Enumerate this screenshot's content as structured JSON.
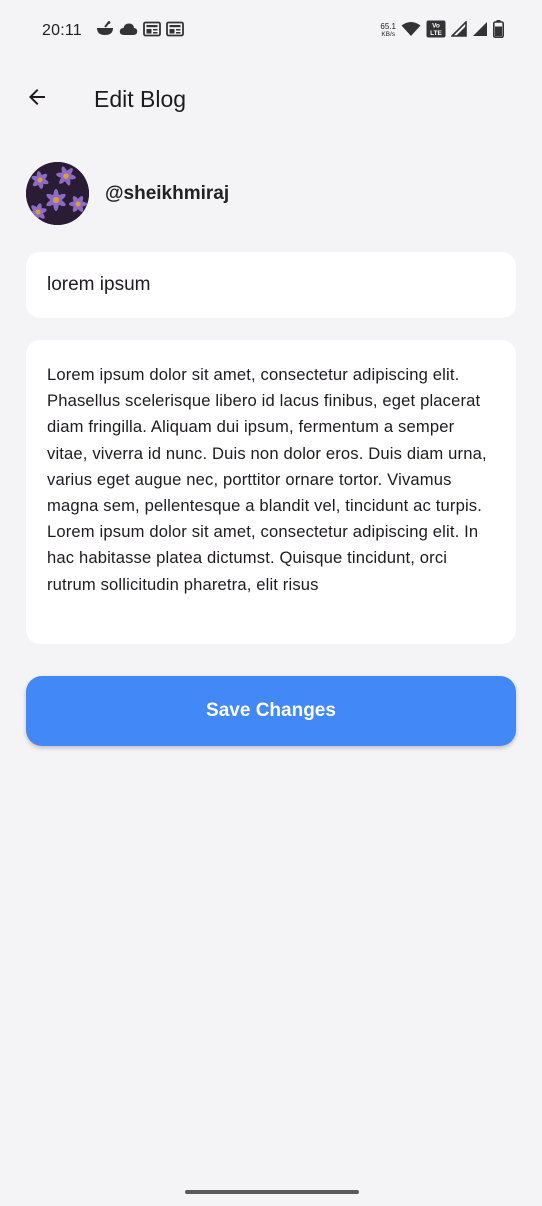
{
  "status_bar": {
    "time": "20:11",
    "net_speed_value": "65.1",
    "net_speed_unit": "KB/s",
    "volte_label": "Vo LTE",
    "left_icons": [
      "cooking-pot-icon",
      "cloud-icon",
      "news-icon",
      "news-icon"
    ],
    "right_icons": [
      "wifi-icon",
      "volte-icon",
      "cell-signal-icon",
      "cell-signal-icon",
      "battery-icon"
    ]
  },
  "app_bar": {
    "back_icon": "arrow-left-icon",
    "title": "Edit Blog"
  },
  "author": {
    "username": "@sheikhmiraj",
    "avatar_image": "purple flowers photo"
  },
  "form": {
    "title_value": "lorem ipsum",
    "body_value": "Lorem ipsum dolor sit amet, consectetur adipiscing elit. Phasellus scelerisque libero id lacus finibus, eget placerat diam fringilla. Aliquam dui ipsum, fermentum a semper vitae, viverra id nunc. Duis non dolor eros. Duis diam urna, varius eget augue nec, porttitor ornare tortor. Vivamus magna sem, pellentesque a blandit vel, tincidunt ac turpis. Lorem ipsum dolor sit amet, consectetur adipiscing elit. In hac habitasse platea dictumst. Quisque tincidunt, orci rutrum sollicitudin pharetra, elit risus",
    "save_label": "Save Changes"
  },
  "colors": {
    "accent": "#4288f7",
    "background": "#f4f4f6",
    "surface": "#ffffff"
  }
}
